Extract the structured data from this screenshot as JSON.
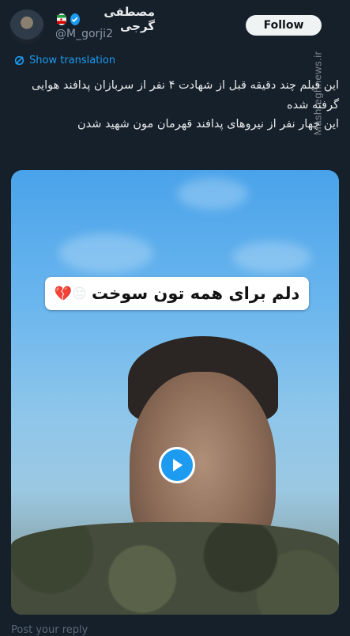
{
  "tweet": {
    "author_name": "مصطفی گرجی",
    "handle": "@M_gorji2",
    "follow_label": "Follow",
    "translate_label": "Show translation",
    "text_lines": [
      "این فیلم چند دقیقه قبل از شهادت ۴ نفر از سربازان پدافند هوایی گرفته شده",
      "این چهار نفر از نیروهای پدافند قهرمان مون شهید شدن"
    ]
  },
  "media": {
    "caption": "دلم برای همه تون سوخت",
    "caption_emoji": "💔😔"
  },
  "watermark": "Mashreghnews.ir",
  "footer_partial": "Post your reply",
  "colors": {
    "background": "#15202b",
    "accent": "#1d9bf0",
    "text": "#e7e9ea",
    "secondary_text": "#8b98a5"
  },
  "icons": [
    "avatar",
    "verified-icon",
    "flag-icon",
    "translate-icon",
    "play-icon"
  ]
}
